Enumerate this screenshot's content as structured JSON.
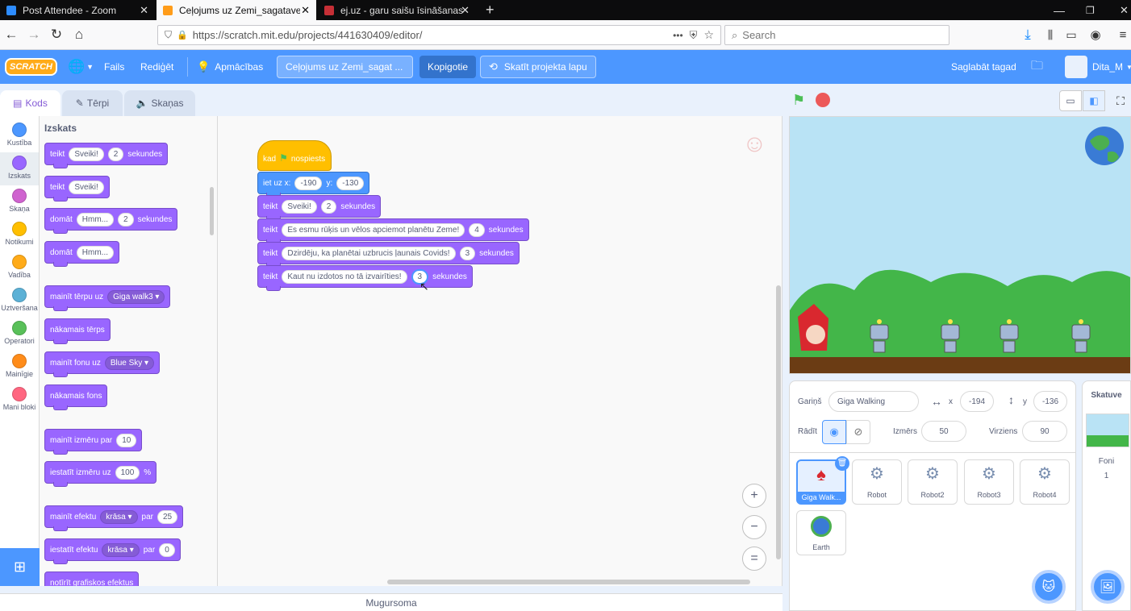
{
  "browser": {
    "tabs": [
      {
        "title": "Post Attendee - Zoom",
        "active": false,
        "color": "#2d8cff"
      },
      {
        "title": "Ceļojums uz Zemi_sagatave on",
        "active": true,
        "color": "#ff9c1a"
      },
      {
        "title": "ej.uz - garu saišu īsināšanas ser",
        "active": false,
        "color": "#c62f36"
      }
    ],
    "new_tab": "+",
    "url": "https://scratch.mit.edu/projects/441630409/editor/",
    "url_domain": "scratch.mit.edu",
    "search_placeholder": "Search",
    "more_dots": "•••"
  },
  "menu": {
    "logo": "SCRATCH",
    "file": "Fails",
    "edit": "Rediģēt",
    "tutorials": "Apmācības",
    "project_title": "Ceļojums uz Zemi_sagat ...",
    "copy": "Kopigotie",
    "see_project": "Skatīt projekta lapu",
    "save_now": "Saglabāt tagad",
    "username": "Dita_M"
  },
  "editor_tabs": {
    "code": "Kods",
    "costumes": "Tērpi",
    "sounds": "Skaņas"
  },
  "categories": [
    {
      "label": "Kustība",
      "color": "#4c97ff"
    },
    {
      "label": "Izskats",
      "color": "#9966ff"
    },
    {
      "label": "Skaņa",
      "color": "#cf63cf"
    },
    {
      "label": "Notikumi",
      "color": "#ffbf00"
    },
    {
      "label": "Vadība",
      "color": "#ffab19"
    },
    {
      "label": "Uztveršana",
      "color": "#5cb1d6"
    },
    {
      "label": "Operatori",
      "color": "#59c059"
    },
    {
      "label": "Mainīgie",
      "color": "#ff8c1a"
    },
    {
      "label": "Mani bloki",
      "color": "#ff6680"
    }
  ],
  "palette": {
    "heading": "Izskats",
    "say_secs": {
      "say": "teikt",
      "text": "Sveiki!",
      "num": "2",
      "unit": "sekundes"
    },
    "say": {
      "say": "teikt",
      "text": "Sveiki!"
    },
    "think_secs": {
      "think": "domāt",
      "text": "Hmm...",
      "num": "2",
      "unit": "sekundes"
    },
    "think": {
      "think": "domāt",
      "text": "Hmm..."
    },
    "switch_costume": {
      "label": "mainīt tērpu uz",
      "value": "Giga walk3"
    },
    "next_costume": "nākamais tērps",
    "switch_backdrop": {
      "label": "mainīt fonu uz",
      "value": "Blue Sky"
    },
    "next_backdrop": "nākamais fons",
    "change_size": {
      "label": "mainīt izmēru par",
      "value": "10"
    },
    "set_size": {
      "label": "iestatīt izmēru uz",
      "value": "100",
      "unit": "%"
    },
    "change_effect": {
      "label": "mainīt efektu",
      "effect": "krāsa",
      "by": "par",
      "value": "25"
    },
    "set_effect": {
      "label": "iestatīt efektu",
      "effect": "krāsa",
      "to": "par",
      "value": "0"
    },
    "clear_effects": "notīrīt grafiskos efektus"
  },
  "script": {
    "hat": {
      "when": "kad",
      "clicked": "nospiests"
    },
    "goto": {
      "label": "iet uz x:",
      "x": "-190",
      "ylabel": "y:",
      "y": "-130"
    },
    "say1": {
      "say": "teikt",
      "text": "Sveiki!",
      "num": "2",
      "unit": "sekundes"
    },
    "say2": {
      "say": "teikt",
      "text": "Es esmu rūķis un vēlos apciemot planētu Zeme!",
      "num": "4",
      "unit": "sekundes"
    },
    "say3": {
      "say": "teikt",
      "text": "Dzirdēju, ka planētai uzbrucis ļaunais Covids!",
      "num": "3",
      "unit": "sekundes"
    },
    "say4": {
      "say": "teikt",
      "text": "Kaut nu izdotos no tā izvairīties!",
      "num": "3",
      "unit": "sekundes"
    }
  },
  "zoom": {
    "in": "+",
    "out": "−",
    "reset": "="
  },
  "backpack": "Mugursoma",
  "sprite_info": {
    "sprite_label": "Gariņš",
    "sprite_name": "Giga Walking",
    "x_label": "x",
    "x": "-194",
    "y_label": "y",
    "y": "-136",
    "show_label": "Rādīt",
    "size_label": "Izmērs",
    "size": "50",
    "direction_label": "Virziens",
    "direction": "90"
  },
  "sprites": [
    {
      "name": "Giga Walk...",
      "selected": true
    },
    {
      "name": "Robot",
      "selected": false
    },
    {
      "name": "Robot2",
      "selected": false
    },
    {
      "name": "Robot3",
      "selected": false
    },
    {
      "name": "Robot4",
      "selected": false
    },
    {
      "name": "Earth",
      "selected": false
    }
  ],
  "stage_pane": {
    "title": "Skatuve",
    "backdrops_label": "Foni",
    "backdrops_count": "1"
  }
}
